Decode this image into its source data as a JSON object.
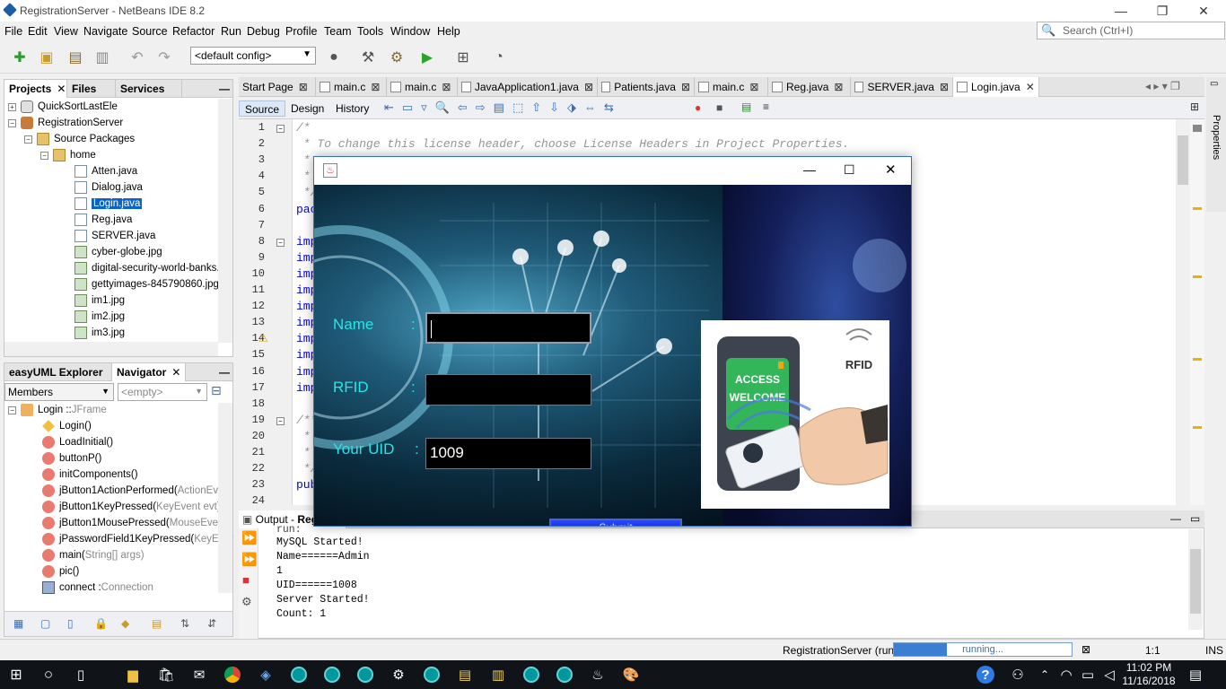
{
  "window": {
    "title": "RegistrationServer - NetBeans IDE 8.2"
  },
  "menu": [
    "File",
    "Edit",
    "View",
    "Navigate",
    "Source",
    "Refactor",
    "Run",
    "Debug",
    "Profile",
    "Team",
    "Tools",
    "Window",
    "Help"
  ],
  "search": {
    "placeholder": "Search (Ctrl+I)"
  },
  "toolbar": {
    "config": "<default config>"
  },
  "projects": {
    "tabs": [
      "Projects",
      "Files",
      "Services"
    ],
    "items": [
      {
        "label": "QuickSortLastEle",
        "kind": "project"
      },
      {
        "label": "RegistrationServer",
        "kind": "project"
      },
      {
        "label": "Source Packages",
        "kind": "folder"
      },
      {
        "label": "home",
        "kind": "package"
      },
      {
        "label": "Atten.java",
        "kind": "java"
      },
      {
        "label": "Dialog.java",
        "kind": "java"
      },
      {
        "label": "Login.java",
        "kind": "java",
        "selected": true
      },
      {
        "label": "Reg.java",
        "kind": "java"
      },
      {
        "label": "SERVER.java",
        "kind": "java"
      },
      {
        "label": "cyber-globe.jpg",
        "kind": "image"
      },
      {
        "label": "digital-security-world-banks.j",
        "kind": "image"
      },
      {
        "label": "gettyimages-845790860.jpg",
        "kind": "image"
      },
      {
        "label": "im1.jpg",
        "kind": "image"
      },
      {
        "label": "im2.jpg",
        "kind": "image"
      },
      {
        "label": "im3.jpg",
        "kind": "image"
      }
    ]
  },
  "navigator": {
    "tabs": [
      "easyUML Explorer",
      "Navigator"
    ],
    "filter": "Members",
    "empty": "<empty>",
    "root": "Login :: ",
    "root_type": "JFrame",
    "members": [
      {
        "name": "Login()",
        "type": ""
      },
      {
        "name": "LoadInitial()",
        "type": ""
      },
      {
        "name": "buttonP()",
        "type": ""
      },
      {
        "name": "initComponents()",
        "type": ""
      },
      {
        "name": "jButton1ActionPerformed(",
        "type": "ActionEver"
      },
      {
        "name": "jButton1KeyPressed(",
        "type": "KeyEvent evt)"
      },
      {
        "name": "jButton1MousePressed(",
        "type": "MouseEvent"
      },
      {
        "name": "jPasswordField1KeyPressed(",
        "type": "KeyEver"
      },
      {
        "name": "main(",
        "type": "String[] args)"
      },
      {
        "name": "pic()",
        "type": ""
      },
      {
        "name": "connect : ",
        "type": "Connection"
      }
    ]
  },
  "editor": {
    "tabs": [
      "Start Page",
      "main.c",
      "main.c",
      "JavaApplication1.java",
      "Patients.java",
      "main.c",
      "Reg.java",
      "SERVER.java",
      "Login.java"
    ],
    "subtabs": [
      "Source",
      "Design",
      "History"
    ],
    "line_numbers": [
      "1",
      "2",
      "3",
      "4",
      "5",
      "6",
      "7",
      "8",
      "9",
      "10",
      "11",
      "12",
      "13",
      "14",
      "15",
      "16",
      "17",
      "18",
      "19",
      "20",
      "21",
      "22",
      "23",
      "24"
    ],
    "lines": [
      {
        "t": "/*",
        "c": "cmt"
      },
      {
        "t": " * To change this license header, choose License Headers in Project Properties.",
        "c": "cmt"
      },
      {
        "t": " *",
        "c": "cmt"
      },
      {
        "t": " *",
        "c": "cmt"
      },
      {
        "t": " */",
        "c": "cmt"
      },
      {
        "t": "pac",
        "c": "kw"
      },
      {
        "t": "",
        "c": ""
      },
      {
        "t": "imp",
        "c": "kw"
      },
      {
        "t": "imp",
        "c": "kw"
      },
      {
        "t": "imp",
        "c": "kw"
      },
      {
        "t": "imp",
        "c": "kw"
      },
      {
        "t": "imp",
        "c": "kw"
      },
      {
        "t": "imp",
        "c": "kw"
      },
      {
        "t": "imp",
        "c": "kw"
      },
      {
        "t": "imp",
        "c": "kw"
      },
      {
        "t": "imp",
        "c": "kw"
      },
      {
        "t": "imp",
        "c": "kw"
      },
      {
        "t": "",
        "c": ""
      },
      {
        "t": "/**",
        "c": "cmt"
      },
      {
        "t": " *",
        "c": "cmt"
      },
      {
        "t": " *",
        "c": "cmt"
      },
      {
        "t": " */",
        "c": "cmt"
      },
      {
        "t": "pub",
        "c": "kw"
      },
      {
        "t": "",
        "c": ""
      }
    ]
  },
  "output": {
    "title": "Output - ",
    "title_bold": "Reg",
    "lines": [
      "run:",
      "MySQL Started!",
      "Name======Admin",
      "1",
      "UID======1008",
      "Server Started!",
      "Count: 1"
    ]
  },
  "status": {
    "task": "RegistrationServer (run)",
    "progress_text": "running...",
    "progress": 0.3,
    "position": "1:1",
    "mode": "INS"
  },
  "taskbar": {
    "time": "11:02 PM",
    "date": "11/16/2018"
  },
  "dialog": {
    "name_label": "Name",
    "rfid_label": "RFID",
    "uid_label": "Your UID",
    "colon": ":",
    "name_value": "",
    "rfid_value": "",
    "uid_value": "1009",
    "submit": "Submit",
    "card_access": "ACCESS",
    "card_welcome": "WELCOME",
    "card_rfid": "RFID"
  }
}
